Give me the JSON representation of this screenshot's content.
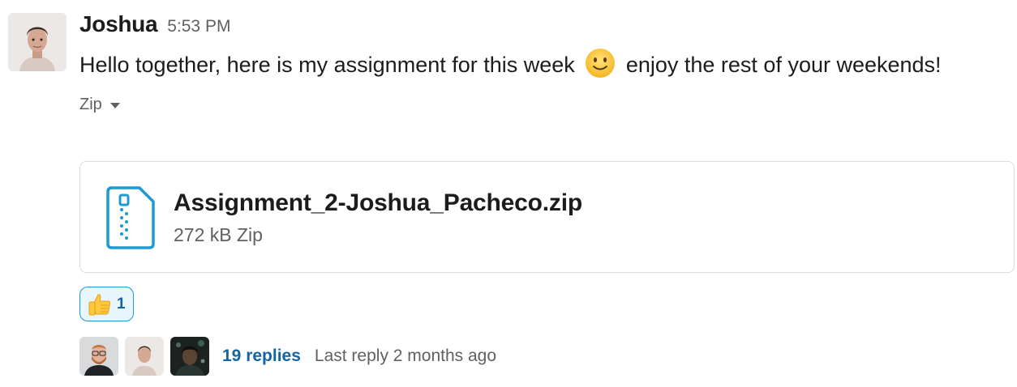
{
  "message": {
    "sender": "Joshua",
    "timestamp": "5:53 PM",
    "text_before_emoji": "Hello together, here is my assignment for this week",
    "emoji": "slightly-smiling-face",
    "text_after_emoji": "enjoy the rest of your weekends!"
  },
  "attachment": {
    "toggle_label": "Zip",
    "file_name": "Assignment_2-Joshua_Pacheco.zip",
    "file_meta": "272 kB Zip",
    "icon": "zip-file-icon",
    "icon_color": "#1d9bd1"
  },
  "reactions": [
    {
      "emoji": "thumbs-up",
      "count": "1"
    }
  ],
  "thread": {
    "participant_avatars": [
      "avatar-bearded-man",
      "avatar-joshua",
      "avatar-dark-photo"
    ],
    "replies_label": "19 replies",
    "last_reply": "Last reply 2 months ago"
  },
  "colors": {
    "link": "#1264a3",
    "reaction_border": "#1d9bd1",
    "reaction_bg": "#e8f5fa",
    "muted_text": "#616061"
  }
}
